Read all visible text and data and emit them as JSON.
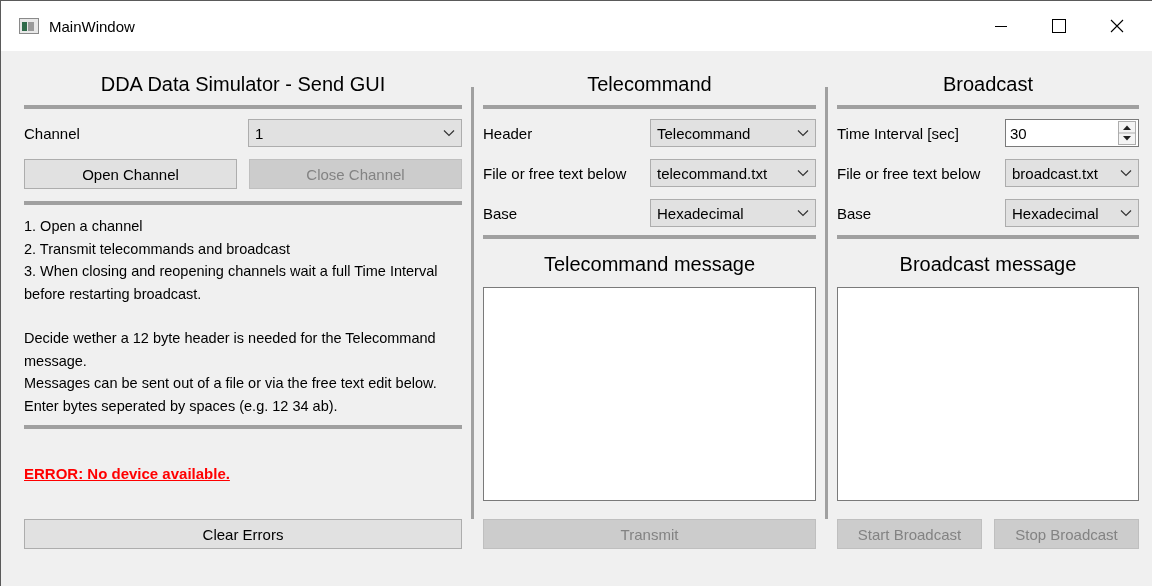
{
  "window": {
    "title": "MainWindow"
  },
  "send_panel": {
    "title": "DDA Data Simulator - Send GUI",
    "channel": {
      "label": "Channel",
      "value": "1"
    },
    "buttons": [
      {
        "label": "Open Channel",
        "disabled": false
      },
      {
        "label": "Close Channel",
        "disabled": true
      }
    ],
    "instructions": [
      "1. Open a channel",
      "2. Transmit telecommands and broadcast",
      "3. When closing and reopening channels wait a full Time Interval before restarting broadcast."
    ],
    "notes": [
      "Decide wether a 12 byte header is needed for the Telecommand message.",
      "Messages can be sent out of a file or via the free text edit below. Enter bytes seperated by spaces (e.g. 12 34 ab)."
    ],
    "error": "ERROR: No device available.",
    "clear_button": {
      "label": "Clear Errors",
      "disabled": false
    }
  },
  "telecommand": {
    "title": "Telecommand",
    "fields": [
      {
        "kind": "combo",
        "label": "Header",
        "value": "Telecommand"
      },
      {
        "kind": "combo",
        "label": "File or free text below",
        "value": "telecommand.txt"
      },
      {
        "kind": "combo",
        "label": "Base",
        "value": "Hexadecimal"
      }
    ],
    "message_title": "Telecommand message",
    "buttons": [
      {
        "label": "Transmit",
        "disabled": true
      }
    ]
  },
  "broadcast": {
    "title": "Broadcast",
    "fields": [
      {
        "kind": "spin",
        "label": "Time Interval [sec]",
        "value": "30"
      },
      {
        "kind": "combo",
        "label": "File or free text below",
        "value": "broadcast.txt"
      },
      {
        "kind": "combo",
        "label": "Base",
        "value": "Hexadecimal"
      }
    ],
    "message_title": "Broadcast message",
    "buttons": [
      {
        "label": "Start Broadcast",
        "disabled": true
      },
      {
        "label": "Stop Broadcast",
        "disabled": true
      }
    ]
  }
}
